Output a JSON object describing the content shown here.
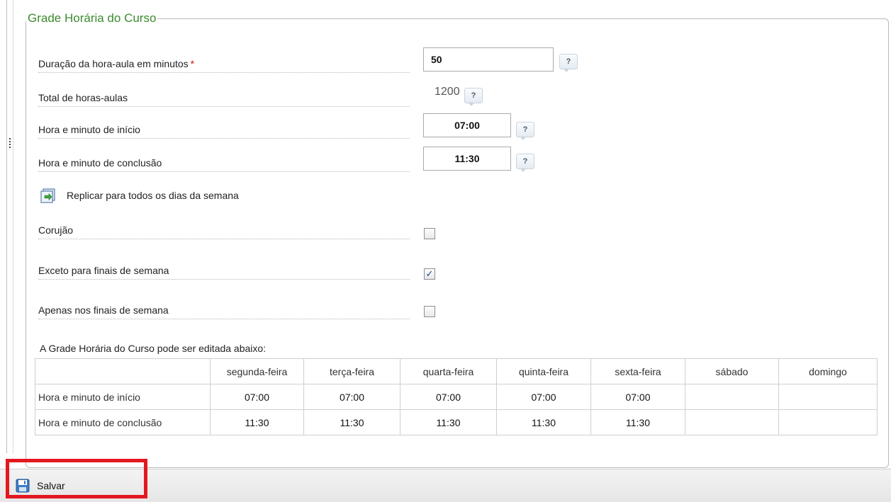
{
  "fieldset": {
    "legend": "Grade Horária do Curso"
  },
  "fields": {
    "duracao": {
      "label": "Duração da hora-aula em minutos",
      "required_mark": "*",
      "value": "50",
      "help": "?"
    },
    "total": {
      "label": "Total de horas-aulas",
      "value": "1200",
      "help": "?"
    },
    "inicio": {
      "label": "Hora e minuto de início",
      "value": "07:00",
      "help": "?"
    },
    "conclusao": {
      "label": "Hora e minuto de conclusão",
      "value": "11:30",
      "help": "?"
    }
  },
  "replicar": {
    "label": "Replicar para todos os dias da semana",
    "icon": "replicate-icon"
  },
  "checkboxes": {
    "corujao": {
      "label": "Corujão",
      "checked": false
    },
    "exceto": {
      "label": "Exceto para finais de semana",
      "checked": true,
      "mark": "✓"
    },
    "apenas": {
      "label": "Apenas nos finais de semana",
      "checked": false
    }
  },
  "grid": {
    "caption": "A Grade Horária do Curso pode ser editada abaixo:",
    "days": [
      "segunda-feira",
      "terça-feira",
      "quarta-feira",
      "quinta-feira",
      "sexta-feira",
      "sábado",
      "domingo"
    ],
    "rows": [
      {
        "label": "Hora e minuto de início",
        "values": [
          "07:00",
          "07:00",
          "07:00",
          "07:00",
          "07:00",
          "",
          ""
        ]
      },
      {
        "label": "Hora e minuto de conclusão",
        "values": [
          "11:30",
          "11:30",
          "11:30",
          "11:30",
          "11:30",
          "",
          ""
        ]
      }
    ]
  },
  "toolbar": {
    "save_label": "Salvar",
    "save_icon": "floppy-disk-icon"
  },
  "colors": {
    "legend": "#3b8a2e",
    "highlight": "#e3191f",
    "required": "#dd1111"
  }
}
